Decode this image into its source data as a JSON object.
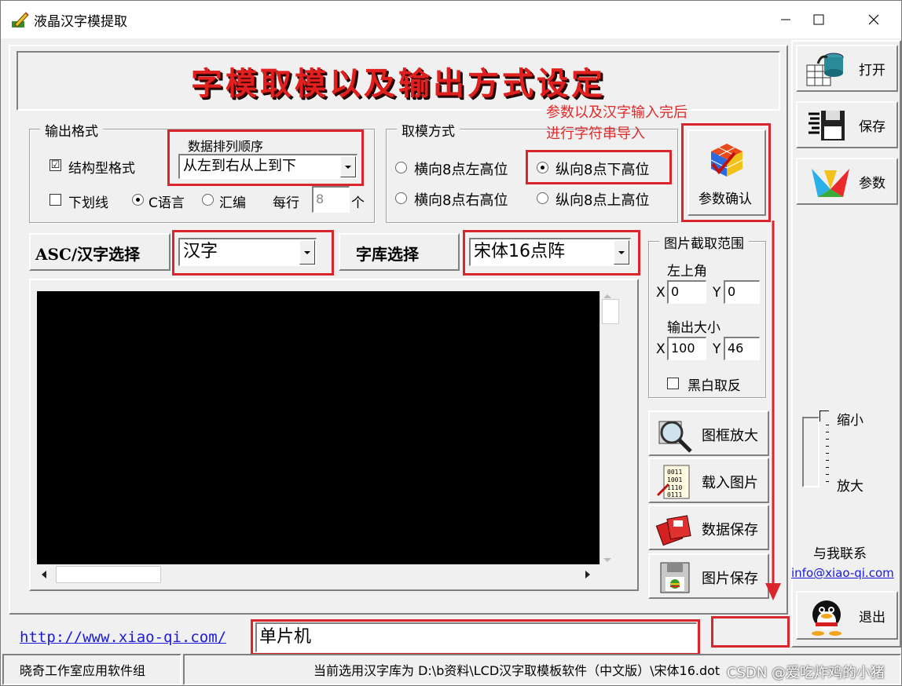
{
  "window": {
    "title": "液晶汉字模提取"
  },
  "headline": "字模取模以及输出方式设定",
  "output_format": {
    "legend": "输出格式",
    "struct_checkbox": "结构型格式",
    "struct_checked": "☑",
    "underline_checkbox": "下划线",
    "c_language": "C语言",
    "assembly": "汇编",
    "per_line_label": "每行",
    "per_line_value": "8",
    "per_line_unit": "个",
    "order_label": "数据排列顺序",
    "order_value": "从左到右从上到下"
  },
  "mode": {
    "legend": "取模方式",
    "options": [
      "横向8点左高位",
      "纵向8点下高位",
      "横向8点右高位",
      "纵向8点上高位"
    ]
  },
  "annotation": {
    "line1": "参数以及汉字输入完后",
    "line2": "进行字符串导入"
  },
  "confirm_button": "参数确认",
  "asc_label": "ASC/汉字选择",
  "asc_value": "汉字",
  "font_label": "字库选择",
  "font_value": "宋体16点阵",
  "capture": {
    "legend": "图片截取范围",
    "top_left": "左上角",
    "x_label": "X",
    "y_label": "Y",
    "x_value": "0",
    "y_value": "0",
    "size_label": "输出大小",
    "w_value": "100",
    "h_value": "46",
    "invert": "黑白取反"
  },
  "tools": {
    "zoom_frame": "图框放大",
    "load_image": "载入图片",
    "save_data": "数据保存",
    "save_image": "图片保存"
  },
  "side": {
    "open": "打开",
    "save": "保存",
    "params": "参数",
    "shrink": "缩小",
    "enlarge": "放大",
    "contact": "与我联系",
    "email": "info@xiao-qi.com",
    "exit": "退出"
  },
  "url": "http://www.xiao-qi.com/",
  "input_text": "单片机",
  "status": {
    "left": "晓奇工作室应用软件组",
    "right": "当前选用汉字库为 D:\\b资料\\LCD汉字取模板软件（中文版）\\宋体16.dot",
    "watermark": "CSDN @爱吃炸鸡的小猪"
  },
  "colors": {
    "accent_red": "#d9252b",
    "headline_red": "#e0201f",
    "link_blue": "#1a1ad8",
    "canvas": "#000000"
  }
}
